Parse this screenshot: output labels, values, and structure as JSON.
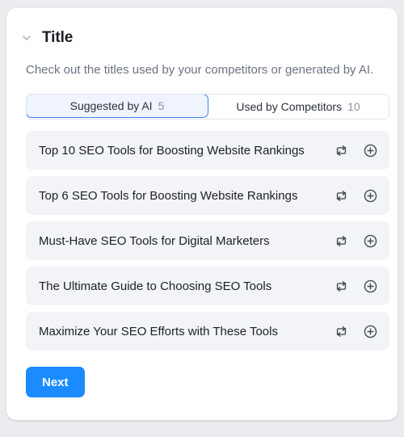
{
  "section": {
    "title": "Title",
    "chevron_icon": "chevron-down-icon",
    "description": "Check out the titles used by your competitors or generated by AI."
  },
  "tabs": [
    {
      "label": "Suggested by AI",
      "count": "5",
      "active": true
    },
    {
      "label": "Used by Competitors",
      "count": "10",
      "active": false
    }
  ],
  "titles": [
    {
      "text": "Top 10 SEO Tools for Boosting Website Rankings"
    },
    {
      "text": "Top 6 SEO Tools for Boosting Website Rankings"
    },
    {
      "text": "Must-Have SEO Tools for Digital Marketers"
    },
    {
      "text": "The Ultimate Guide to Choosing SEO Tools"
    },
    {
      "text": "Maximize Your SEO Efforts with These Tools"
    }
  ],
  "row_icons": {
    "regenerate": "repeat-arrows-icon",
    "add": "circle-plus-icon"
  },
  "footer": {
    "next_label": "Next"
  },
  "colors": {
    "accent": "#1a8cff",
    "tab_active_border": "#3b82f6",
    "tab_active_bg": "#eff4fe",
    "row_bg": "#f3f4f7",
    "page_bg": "#ebecef"
  }
}
